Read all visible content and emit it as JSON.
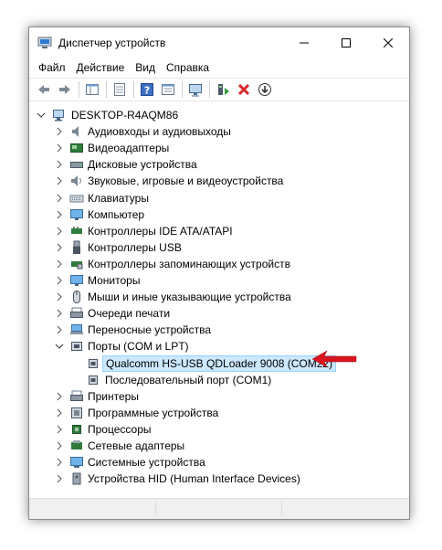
{
  "window": {
    "title": "Диспетчер устройств"
  },
  "menu": [
    "Файл",
    "Действие",
    "Вид",
    "Справка"
  ],
  "toolbar": {
    "buttons": [
      "back-icon",
      "forward-icon",
      "|",
      "properties-sheet-icon",
      "|",
      "list-icon",
      "|",
      "help-icon",
      "view-icon",
      "|",
      "monitor-scan-icon",
      "|",
      "update-driver-icon",
      "remove-device-icon",
      "download-icon"
    ]
  },
  "tree": {
    "root": "DESKTOP-R4AQM86",
    "items": [
      {
        "label": "Аудиовходы и аудиовыходы",
        "icon": "speaker-icon"
      },
      {
        "label": "Видеоадаптеры",
        "icon": "display-adapter-icon"
      },
      {
        "label": "Дисковые устройства",
        "icon": "disk-icon"
      },
      {
        "label": "Звуковые, игровые и видеоустройства",
        "icon": "sound-icon"
      },
      {
        "label": "Клавиатуры",
        "icon": "keyboard-icon"
      },
      {
        "label": "Компьютер",
        "icon": "computer-icon"
      },
      {
        "label": "Контроллеры IDE ATA/ATAPI",
        "icon": "ide-controller-icon"
      },
      {
        "label": "Контроллеры USB",
        "icon": "usb-icon"
      },
      {
        "label": "Контроллеры запоминающих устройств",
        "icon": "storage-controller-icon"
      },
      {
        "label": "Мониторы",
        "icon": "monitor-icon"
      },
      {
        "label": "Мыши и иные указывающие устройства",
        "icon": "mouse-icon"
      },
      {
        "label": "Очереди печати",
        "icon": "print-queue-icon"
      },
      {
        "label": "Переносные устройства",
        "icon": "portable-device-icon"
      },
      {
        "label": "Порты (COM и LPT)",
        "icon": "port-icon",
        "expanded": true
      },
      {
        "label": "Принтеры",
        "icon": "printer-icon"
      },
      {
        "label": "Программные устройства",
        "icon": "software-device-icon"
      },
      {
        "label": "Процессоры",
        "icon": "processor-icon"
      },
      {
        "label": "Сетевые адаптеры",
        "icon": "network-adapter-icon"
      },
      {
        "label": "Системные устройства",
        "icon": "system-device-icon"
      },
      {
        "label": "Устройства HID (Human Interface Devices)",
        "icon": "hid-icon"
      }
    ],
    "port_children": [
      {
        "label": "Qualcomm HS-USB QDLoader 9008 (COM22)",
        "selected": true
      },
      {
        "label": "Последовательный порт (COM1)",
        "selected": false
      }
    ]
  },
  "colors": {
    "selection": "#cce8ff",
    "arrow": "#d9151f",
    "accent": "#0078d7"
  }
}
